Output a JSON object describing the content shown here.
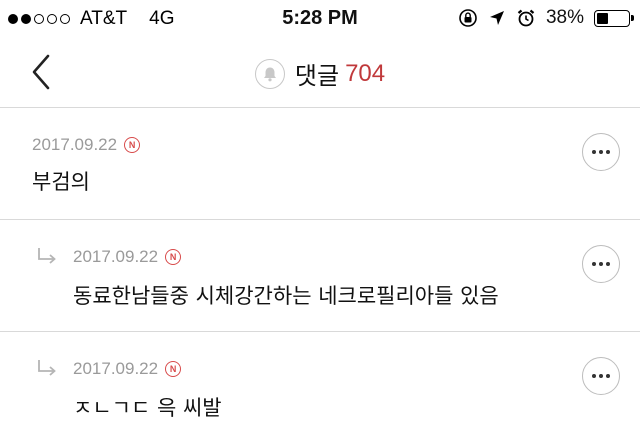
{
  "status_bar": {
    "carrier": "AT&T",
    "network": "4G",
    "time": "5:28 PM",
    "battery_percent": "38%",
    "battery_level": 0.38,
    "signal_bars_filled": 2,
    "signal_bars_total": 5,
    "icons": [
      "orientation-lock-icon",
      "location-arrow-icon",
      "alarm-icon",
      "battery-icon"
    ]
  },
  "nav": {
    "back_icon": "chevron-left-icon",
    "bell_icon": "bell-icon",
    "title": "댓글",
    "count": "704",
    "accent_color": "#c0393b"
  },
  "comments": [
    {
      "date": "2017.09.22",
      "badge": "N",
      "text": "부검의",
      "is_reply": false
    },
    {
      "date": "2017.09.22",
      "badge": "N",
      "text": "동료한남들중 시체강간하는 네크로필리아들 있음",
      "is_reply": true
    },
    {
      "date": "2017.09.22",
      "badge": "N",
      "text": "ㅈㄴㄱㄷ 윽 씨발",
      "is_reply": true
    }
  ]
}
